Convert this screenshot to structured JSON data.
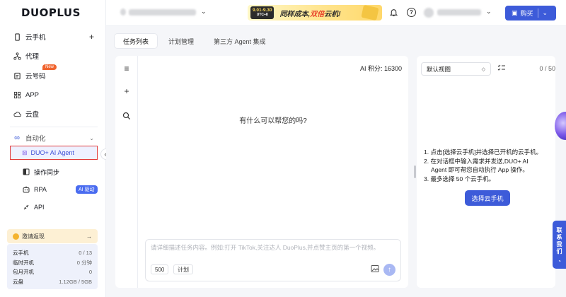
{
  "logo": "DUOPLUS",
  "sidebar": {
    "items": [
      {
        "label": "云手机",
        "icon": "phone-icon"
      },
      {
        "label": "代理",
        "icon": "proxy-icon"
      },
      {
        "label": "云号码",
        "icon": "number-icon",
        "badge": "New"
      },
      {
        "label": "APP",
        "icon": "app-grid-icon"
      },
      {
        "label": "云盘",
        "icon": "cloud-icon"
      }
    ],
    "automation": {
      "label": "自动化",
      "icon": "infinity-icon"
    },
    "sub_items": [
      {
        "label": "DUO+ AI Agent",
        "icon": "agent-icon"
      },
      {
        "label": "操作同步",
        "icon": "sync-icon"
      },
      {
        "label": "RPA",
        "icon": "rpa-icon",
        "badge": "AI 驱动"
      },
      {
        "label": "API",
        "icon": "api-icon"
      }
    ],
    "collapse_glyph": "«",
    "invite": {
      "label": "邀请返现",
      "arrow": "→"
    },
    "usage": [
      {
        "label": "云手机",
        "value": "0 / 13"
      },
      {
        "label": "临时开机",
        "value": "0 分钟"
      },
      {
        "label": "包月开机",
        "value": "0"
      },
      {
        "label": "云盘",
        "value": "1.12GB / 5GB"
      }
    ]
  },
  "header": {
    "promo_date": "9.01-9.30",
    "promo_tz": "UTC+8",
    "promo_text_a": "同样成本,",
    "promo_text_b": "双倍",
    "promo_text_c": "云机!",
    "buy_label": "购买"
  },
  "tabs": [
    {
      "label": "任务列表",
      "active": true
    },
    {
      "label": "计划管理",
      "active": false
    },
    {
      "label": "第三方 Agent 集成",
      "active": false
    }
  ],
  "chat": {
    "points": "AI 积分: 16300",
    "greeting": "有什么可以帮您的吗?",
    "placeholder": "请详细描述任务内容。例如:打开 TikTok,关注达人 DuoPlus,并点赞主页的第一个视频。",
    "chip_count": "500",
    "chip_plan": "计划"
  },
  "right": {
    "view_select": "默认视图",
    "count": "0 / 50",
    "steps": [
      "1. 点击[选择云手机]并选择已开机的云手机。",
      "2. 在对话框中输入需求并发送,DUO+ AI",
      "   Agent 即可帮您自动执行 App 操作。",
      "3. 最多选择 50 个云手机。"
    ],
    "pick_button": "选择云手机"
  },
  "contact": [
    "联",
    "系",
    "我",
    "们"
  ]
}
